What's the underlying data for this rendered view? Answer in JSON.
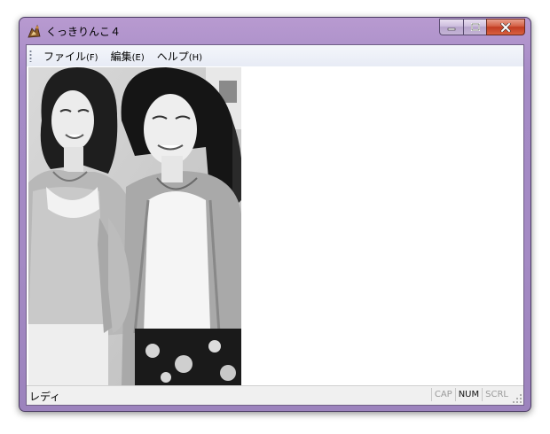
{
  "window": {
    "title": "くっきりんこ４"
  },
  "menu": {
    "items": [
      {
        "label": "ファイル",
        "accel": "(F)"
      },
      {
        "label": "編集",
        "accel": "(E)"
      },
      {
        "label": "ヘルプ",
        "accel": "(H)"
      }
    ]
  },
  "content": {
    "image": "grayscale-photo-two-women-icon"
  },
  "status": {
    "text": "レディ",
    "indicators": [
      {
        "label": "CAP",
        "active": false
      },
      {
        "label": "NUM",
        "active": true
      },
      {
        "label": "SCRL",
        "active": false
      }
    ]
  },
  "colors": {
    "frame": "#a48ac4",
    "close_button": "#c13c22",
    "menubar": "#e7ebf5"
  }
}
